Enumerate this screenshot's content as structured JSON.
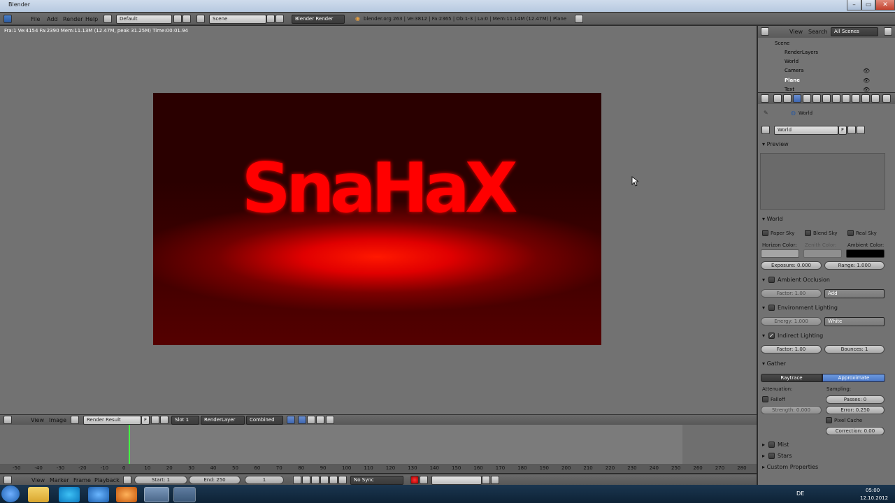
{
  "window": {
    "title": "Blender"
  },
  "menubar": {
    "menus": [
      "File",
      "Add",
      "Render",
      "Help"
    ],
    "screen_layout": "Default",
    "scene": "Scene",
    "engine": "Blender Render",
    "stats": "blender.org 263 | Ve:3812 | Fa:2365 | Ob:1-3 | La:0 | Mem:11.14M (12.47M) | Plane"
  },
  "viewport": {
    "info": "Fra:1  Ve:4154 Fa:2390 Mem:11.13M (12.47M, peak 31.25M) Time:00:01.94",
    "render_text": "SnaHaX"
  },
  "image_header": {
    "menus": [
      "View",
      "Image"
    ],
    "image": "Render Result",
    "fake_user": "F",
    "slot": "Slot 1",
    "layer": "RenderLayer",
    "pass": "Combined"
  },
  "timeline": {
    "ticks": [
      "-50",
      "-40",
      "-30",
      "-20",
      "-10",
      "0",
      "10",
      "20",
      "30",
      "40",
      "50",
      "60",
      "70",
      "80",
      "90",
      "100",
      "110",
      "120",
      "130",
      "140",
      "150",
      "160",
      "170",
      "180",
      "190",
      "200",
      "210",
      "220",
      "230",
      "240",
      "250",
      "260",
      "270",
      "280"
    ],
    "menus": [
      "View",
      "Marker",
      "Frame",
      "Playback"
    ],
    "start": "Start: 1",
    "end": "End: 250",
    "current": "1",
    "sync": "No Sync"
  },
  "outliner": {
    "menus": [
      "View",
      "Search"
    ],
    "filter": "All Scenes",
    "items": [
      "Scene",
      "RenderLayers",
      "World",
      "Camera",
      "Plane",
      "Text"
    ]
  },
  "properties": {
    "breadcrumb": "World",
    "world_name": "World",
    "fake_user": "F",
    "panels": {
      "preview": "Preview",
      "world": "World",
      "paper_sky": "Paper Sky",
      "blend_sky": "Blend Sky",
      "real_sky": "Real Sky",
      "horizon_color": "Horizon Color:",
      "zenith_color": "Zenith Color:",
      "ambient_color": "Ambient Color:",
      "exposure": "Exposure: 0.000",
      "range": "Range: 1.000",
      "ao": "Ambient Occlusion",
      "ao_factor": "Factor: 1.00",
      "ao_mode": "Add",
      "env": "Environment Lighting",
      "env_energy": "Energy: 1.000",
      "env_color": "White",
      "indirect": "Indirect Lighting",
      "ind_factor": "Factor: 1.00",
      "ind_bounces": "Bounces: 1",
      "gather": "Gather",
      "raytrace": "Raytrace",
      "approximate": "Approximate",
      "attenuation": "Attenuation:",
      "sampling": "Sampling:",
      "falloff": "Falloff",
      "passes": "Passes: 0",
      "strength": "Strength: 0.000",
      "error": "Error: 0.250",
      "pixel_cache": "Pixel Cache",
      "correction": "Correction: 0.00",
      "mist": "Mist",
      "stars": "Stars",
      "custom": "Custom Properties"
    }
  },
  "taskbar": {
    "lang": "DE",
    "time": "05:00",
    "date": "12.10.2012"
  },
  "colors": {
    "accent": "#5680c2",
    "render_red": "#ff0000",
    "horizon": "#a5a5a5",
    "ambient": "#000000"
  }
}
